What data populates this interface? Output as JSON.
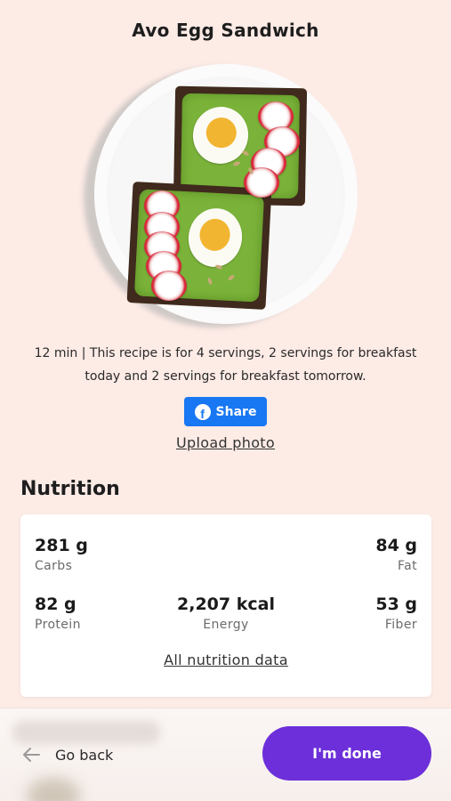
{
  "recipe": {
    "title": "Avo Egg Sandwich",
    "description": "12 min | This recipe is for 4 servings, 2 servings for breakfast today and 2 servings for breakfast tomorrow."
  },
  "actions": {
    "share_label": "Share",
    "share_icon": "facebook-icon",
    "upload_label": "Upload photo"
  },
  "nutrition": {
    "heading": "Nutrition",
    "stats": {
      "carbs": {
        "value": "281 g",
        "label": "Carbs"
      },
      "fat": {
        "value": "84 g",
        "label": "Fat"
      },
      "protein": {
        "value": "82 g",
        "label": "Protein"
      },
      "energy": {
        "value": "2,207 kcal",
        "label": "Energy"
      },
      "fiber": {
        "value": "53 g",
        "label": "Fiber"
      }
    },
    "all_link": "All nutrition data"
  },
  "footer": {
    "back_label": "Go back",
    "back_icon": "arrow-left-icon",
    "done_label": "I'm done"
  },
  "colors": {
    "background": "#fdebe6",
    "facebook": "#1877f2",
    "primary": "#6c2fd9"
  }
}
